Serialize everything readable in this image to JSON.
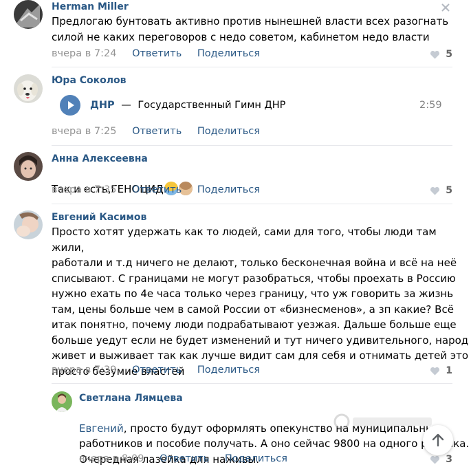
{
  "comments": [
    {
      "author": "Herman Miller",
      "text": "Предлогаю бунтовать активно против нынешней власти всех разогнать\nсилой не каких переговоров с недо советом, кабинетом недо власти",
      "time": "вчера в 7:24",
      "reply_label": "Ответить",
      "share_label": "Поделиться",
      "likes": "5"
    },
    {
      "author": "Юра Соколов",
      "audio": {
        "artist": "ДНР",
        "dash": "—",
        "title": "Государственный Гимн ДНР",
        "duration": "2:59"
      },
      "time": "вчера в 7:25",
      "reply_label": "Ответить",
      "share_label": "Поделиться"
    },
    {
      "author": "Анна Алексеевна",
      "text": "Так и есть,ГЕНОЦИД",
      "time": "вчера в 7:35",
      "reply_label": "Ответить",
      "share_label": "Поделиться",
      "likes": "5"
    },
    {
      "author": "Евгений Касимов",
      "text": "Просто хотят удержать как то людей, сами для того, чтобы люди там жили,\nработали и т.д ничего не делают, только бесконечная война и всё на неё\nсписывают. С границами не могут разобраться, чтобы проехать в Россию\nнужно ехать по 4е часа только через границу, что уж говорить за жизнь\nтам, цены больше чем в самой России от «бизнесменов», а зп какие? Всё\nитак понятно, почему люди подрабатывают уезжая. Дальше больше еще\nбольше уедут если не будет изменений и тут ничего удивительного, народ\nживет и выживает так как лучше видит сам для себя и отнимать детей это\nпросто безумие властей",
      "time": "вчера в 7:39",
      "reply_label": "Ответить",
      "share_label": "Поделиться",
      "likes": "1"
    },
    {
      "author": "Светлана Лямцева",
      "mention": "Евгений",
      "text": ", просто будут оформлять опекунство на муниципальных\nработников и пособие получать. А оно сейчас 9800 на одного ребенка.\nОчередная лазейка для наживы.",
      "time": "вчера в 8:09",
      "reply_label": "Ответить",
      "share_label": "Поделиться",
      "likes": "3"
    }
  ],
  "icons": {
    "close": "close-icon",
    "like": "heart-icon",
    "play": "play-icon",
    "scroll_up": "arrow-up-icon"
  },
  "colors": {
    "link": "#2a5885",
    "meta": "#939393",
    "play_button": "#5181b8"
  }
}
